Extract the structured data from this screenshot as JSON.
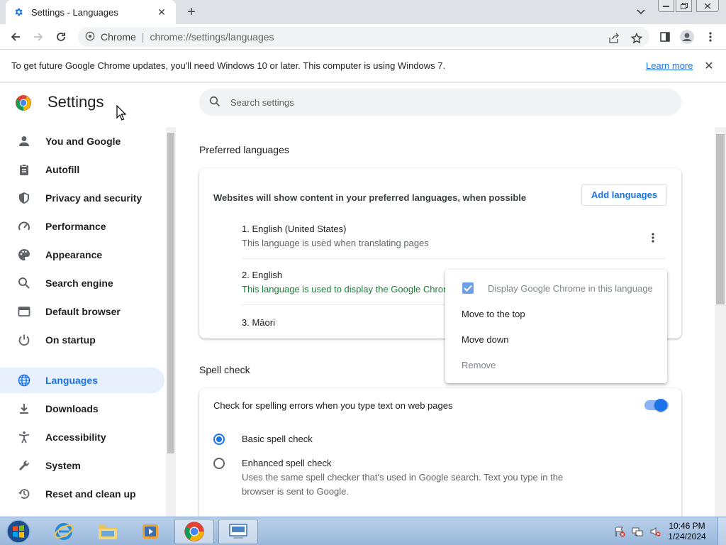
{
  "browser": {
    "tab_title": "Settings - Languages",
    "new_tab": "+",
    "omnibox_site": "Chrome",
    "omnibox_sep": "|",
    "omnibox_url": "chrome://settings/languages"
  },
  "infobar": {
    "message": "To get future Google Chrome updates, you'll need Windows 10 or later. This computer is using Windows 7.",
    "learn_more": "Learn more",
    "close": "✕"
  },
  "settings": {
    "title": "Settings",
    "search_placeholder": "Search settings"
  },
  "sidebar": {
    "items": [
      {
        "label": "You and Google",
        "icon": "person-icon"
      },
      {
        "label": "Autofill",
        "icon": "clipboard-icon"
      },
      {
        "label": "Privacy and security",
        "icon": "shield-icon"
      },
      {
        "label": "Performance",
        "icon": "speedometer-icon"
      },
      {
        "label": "Appearance",
        "icon": "palette-icon"
      },
      {
        "label": "Search engine",
        "icon": "search-icon"
      },
      {
        "label": "Default browser",
        "icon": "browser-icon"
      },
      {
        "label": "On startup",
        "icon": "power-icon"
      },
      {
        "label": "Languages",
        "icon": "globe-icon",
        "active": true
      },
      {
        "label": "Downloads",
        "icon": "download-icon"
      },
      {
        "label": "Accessibility",
        "icon": "accessibility-icon"
      },
      {
        "label": "System",
        "icon": "wrench-icon"
      },
      {
        "label": "Reset and clean up",
        "icon": "restore-icon"
      }
    ]
  },
  "preferred_languages": {
    "section_title": "Preferred languages",
    "description": "Websites will show content in your preferred languages, when possible",
    "add_button": "Add languages",
    "languages": [
      {
        "name": "1. English (United States)",
        "note": "This language is used when translating pages"
      },
      {
        "name": "2. English",
        "note": "This language is used to display the Google Chrome UI"
      },
      {
        "name": "3. Māori",
        "note": ""
      }
    ]
  },
  "context_menu": {
    "items": [
      {
        "label": "Display Google Chrome in this language",
        "checked": true,
        "disabled": true
      },
      {
        "label": "Move to the top"
      },
      {
        "label": "Move down"
      },
      {
        "label": "Remove",
        "disabled": true
      }
    ]
  },
  "spell_check": {
    "section_title": "Spell check",
    "toggle_label": "Check for spelling errors when you type text on web pages",
    "toggle_on": true,
    "options": [
      {
        "label": "Basic spell check",
        "checked": true
      },
      {
        "label": "Enhanced spell check",
        "desc1": "Uses the same spell checker that's used in Google search. Text you type in the",
        "desc2": "browser is sent to Google.",
        "checked": false
      }
    ]
  },
  "taskbar": {
    "time": "10:46 PM",
    "date": "1/24/2024"
  },
  "colors": {
    "accent": "#1a73e8",
    "active_bg": "#e8f0fe",
    "green_note": "#188038"
  }
}
